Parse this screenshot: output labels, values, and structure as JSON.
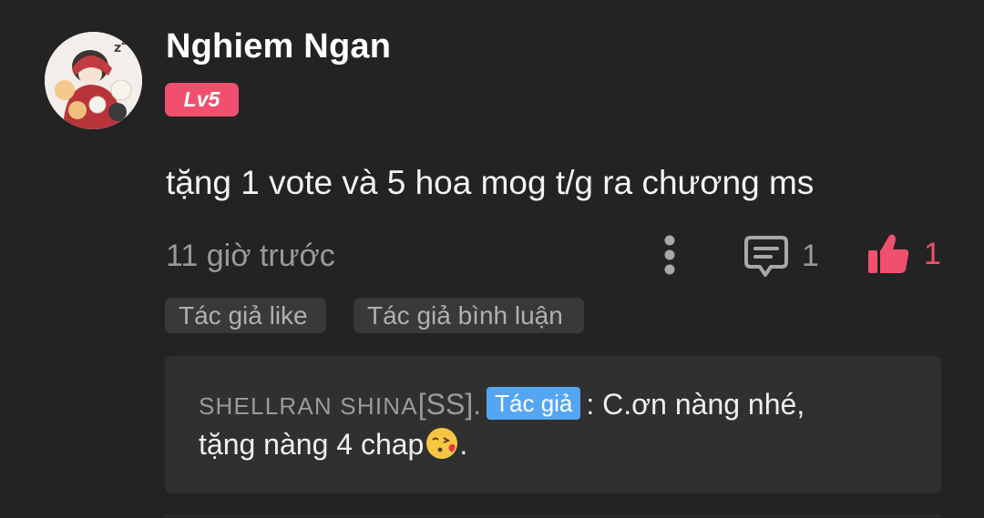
{
  "comment": {
    "username": "Nghiem Ngan",
    "level": "Lv5",
    "text": "tặng 1 vote và 5 hoa mog t/g ra chương ms",
    "timestamp": "11 giờ trước",
    "reply_count": "1",
    "like_count": "1",
    "icons": [
      "avatar",
      "more-vert-icon",
      "comment-icon",
      "thumbs-up-icon"
    ],
    "colors": {
      "accent": "#f0506e",
      "author_badge": "#55a6f2",
      "background": "#232323"
    }
  },
  "tags": {
    "like": "Tác giả like",
    "reply": "Tác giả bình luận"
  },
  "reply": {
    "author": "SHELLRAN SHINA",
    "author_suffix": "[SS].",
    "badge": "Tác giả",
    "text_line1": ": C.ơn nàng nhé,",
    "text_line2": "tặng nàng 4 chap",
    "text_line2_end": ".",
    "emoji": "kissing-face-emoji"
  }
}
